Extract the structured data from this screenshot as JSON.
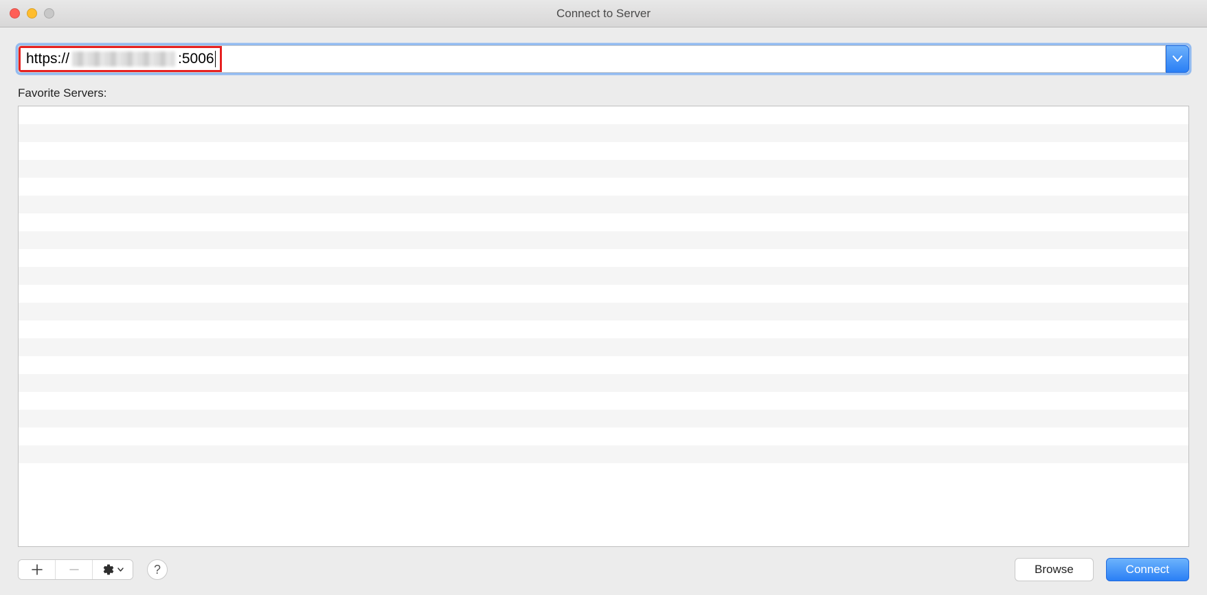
{
  "window": {
    "title": "Connect to Server"
  },
  "address": {
    "protocol": "https://",
    "port": ":5006",
    "redacted_text": ""
  },
  "favorites": {
    "label": "Favorite Servers:",
    "row_count": 20
  },
  "toolbar": {
    "add_label": "+",
    "remove_label": "−",
    "help_label": "?"
  },
  "buttons": {
    "browse": "Browse",
    "connect": "Connect"
  }
}
